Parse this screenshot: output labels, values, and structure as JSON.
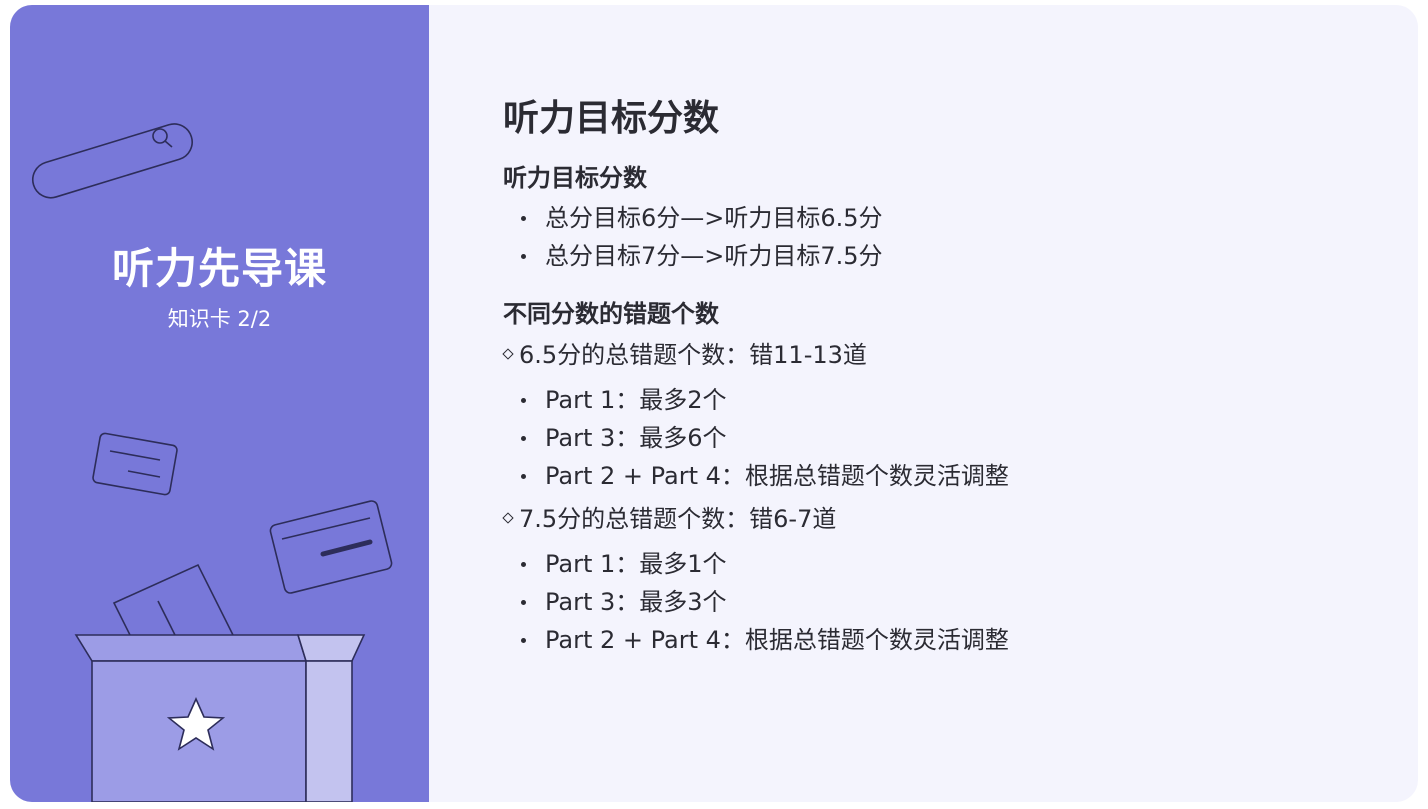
{
  "left_panel": {
    "course_title": "听力先导课",
    "card_label": "知识卡 2/2"
  },
  "content": {
    "page_title": "听力目标分数",
    "section1": {
      "title": "听力目标分数",
      "items": [
        "总分目标6分—>听力目标6.5分",
        "总分目标7分—>听力目标7.5分"
      ]
    },
    "section2": {
      "title": "不同分数的错题个数",
      "groups": [
        {
          "heading": "6.5分的总错题个数：错11-13道",
          "items": [
            "Part 1：最多2个",
            "Part 3：最多6个",
            "Part 2 + Part 4：根据总错题个数灵活调整"
          ]
        },
        {
          "heading": "7.5分的总错题个数：错6-7道",
          "items": [
            "Part 1：最多1个",
            "Part 3：最多3个",
            "Part 2 + Part 4：根据总错题个数灵活调整"
          ]
        }
      ]
    }
  },
  "colors": {
    "panel": "#7878d9",
    "background": "#f4f4fd",
    "text": "#2b2b33"
  }
}
